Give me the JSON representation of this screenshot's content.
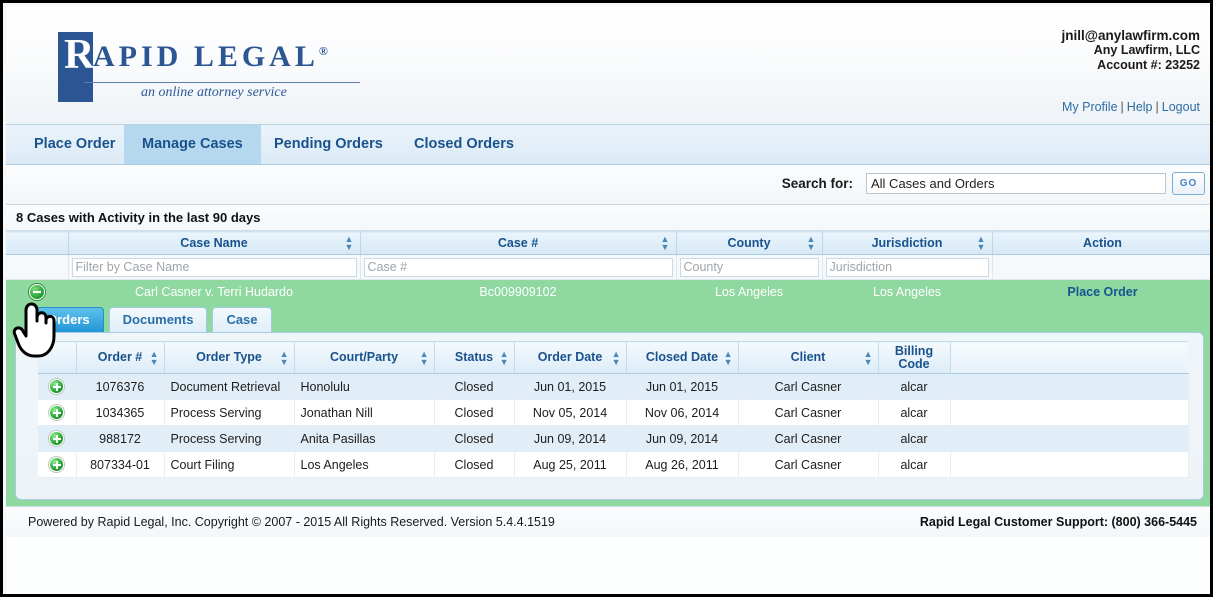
{
  "account": {
    "email": "jnill@anylawfirm.com",
    "firm": "Any Lawfirm, LLC",
    "account_number": "Account #: 23252"
  },
  "logo": {
    "initial": "R",
    "word": "APID LEGAL",
    "registered": "®",
    "tagline": "an online attorney service"
  },
  "top_links": {
    "my_profile": "My Profile",
    "help": "Help",
    "logout": "Logout",
    "separator": "|"
  },
  "nav_tabs": [
    {
      "label": "Place Order",
      "active": false
    },
    {
      "label": "Manage Cases",
      "active": true
    },
    {
      "label": "Pending Orders",
      "active": false
    },
    {
      "label": "Closed Orders",
      "active": false
    }
  ],
  "search": {
    "label": "Search for:",
    "value": "All Cases and Orders",
    "placeholder": "All Cases and Orders",
    "go_label": "GO"
  },
  "cases": {
    "title": "8 Cases with Activity in the last 90 days",
    "columns": [
      "",
      "Case Name",
      "Case #",
      "County",
      "Jurisdiction",
      "Action"
    ],
    "filters": {
      "case_name_placeholder": "Filter by Case Name",
      "case_number_placeholder": "Case #",
      "county_placeholder": "County",
      "jurisdiction_placeholder": "Jurisdiction"
    },
    "selected_row": {
      "case_name": "Carl Casner v. Terri Hudardo",
      "case_number": "Bc009909102",
      "county": "Los Angeles",
      "jurisdiction": "Los Angeles",
      "action": "Place Order",
      "expand_icon": "minus-circle-icon"
    }
  },
  "detail_tabs": [
    {
      "label": "Orders",
      "active": true
    },
    {
      "label": "Documents",
      "active": false
    },
    {
      "label": "Case",
      "active": false
    }
  ],
  "orders": {
    "columns": [
      "",
      "Order #",
      "Order Type",
      "Court/Party",
      "Status",
      "Order Date",
      "Closed Date",
      "Client",
      "Billing Code"
    ],
    "rows": [
      {
        "order_number": "1076376",
        "order_type": "Document Retrieval",
        "court_party": "Honolulu",
        "status": "Closed",
        "order_date": "Jun 01, 2015",
        "closed_date": "Jun 01, 2015",
        "client": "Carl Casner",
        "billing_code": "alcar"
      },
      {
        "order_number": "1034365",
        "order_type": "Process Serving",
        "court_party": "Jonathan Nill",
        "status": "Closed",
        "order_date": "Nov 05, 2014",
        "closed_date": "Nov 06, 2014",
        "client": "Carl Casner",
        "billing_code": "alcar"
      },
      {
        "order_number": "988172",
        "order_type": "Process Serving",
        "court_party": "Anita Pasillas",
        "status": "Closed",
        "order_date": "Jun 09, 2014",
        "closed_date": "Jun 09, 2014",
        "client": "Carl Casner",
        "billing_code": "alcar"
      },
      {
        "order_number": "807334-01",
        "order_type": "Court Filing",
        "court_party": "Los Angeles",
        "status": "Closed",
        "order_date": "Aug 25, 2011",
        "closed_date": "Aug 26, 2011",
        "client": "Carl Casner",
        "billing_code": "alcar"
      }
    ]
  },
  "footer": {
    "left": "Powered by Rapid Legal, Inc. Copyright © 2007 - 2015 All Rights Reserved.  Version 5.4.4.1519",
    "right": "Rapid Legal Customer Support: (800) 366-5445"
  },
  "colors": {
    "brand_blue": "#2c5693",
    "link_blue": "#2e6da4",
    "selected_green": "#8fd9a0",
    "active_tab_blue": "#b5d8ef",
    "row_stripe": "#e2eef7"
  }
}
